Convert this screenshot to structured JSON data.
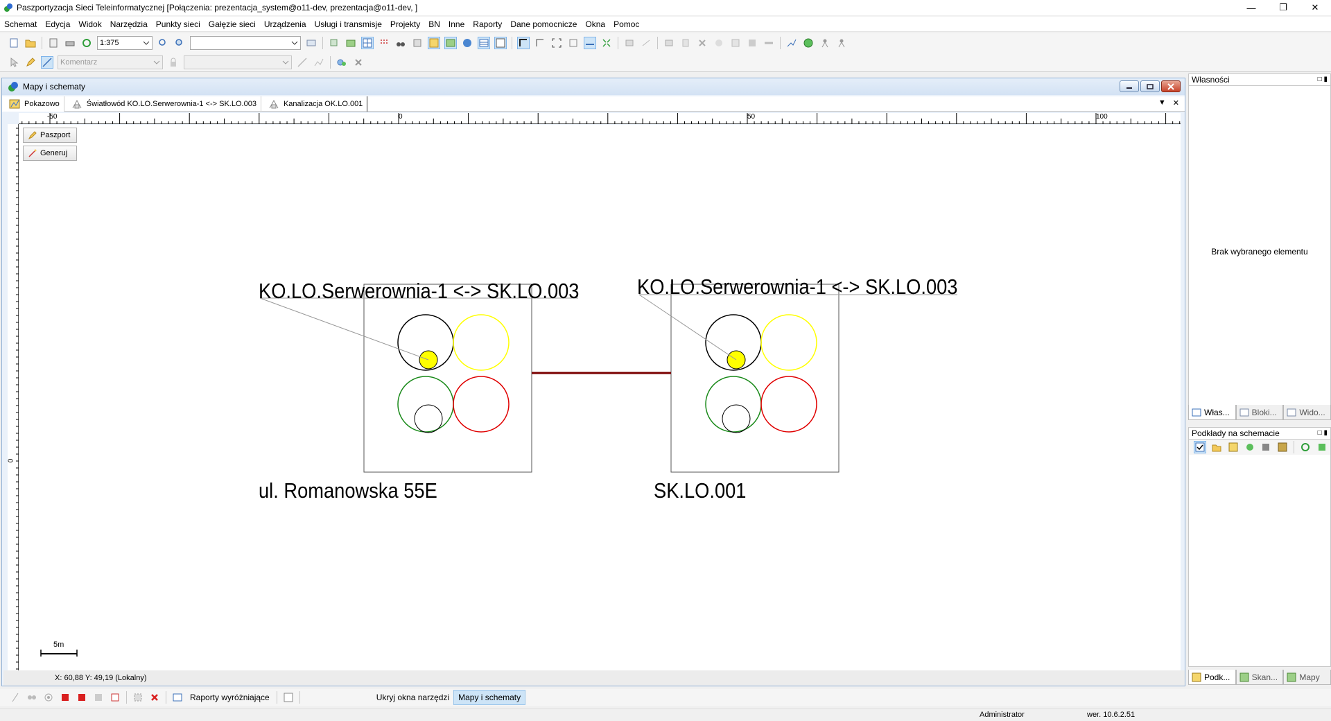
{
  "window": {
    "title": "Paszportyzacja Sieci Teleinformatycznej [Połączenia: prezentacja_system@o11-dev, prezentacja@o11-dev, ]"
  },
  "menu": [
    "Schemat",
    "Edycja",
    "Widok",
    "Narzędzia",
    "Punkty sieci",
    "Gałęzie sieci",
    "Urządzenia",
    "Usługi i transmisje",
    "Projekty",
    "BN",
    "Inne",
    "Raporty",
    "Dane pomocnicze",
    "Okna",
    "Pomoc"
  ],
  "toolbar": {
    "scale": "1:375",
    "layer_placeholder": "",
    "comment_placeholder": "Komentarz"
  },
  "mdi": {
    "title": "Mapy i schematy",
    "tabs": [
      {
        "label": "Pokazowo",
        "icon": "map-icon"
      },
      {
        "label": "Światłowód KO.LO.Serwerownia-1 <-> SK.LO.003",
        "icon": "duct-icon"
      },
      {
        "label": "Kanalizacja OK.LO.001",
        "icon": "duct-icon"
      }
    ],
    "ruler_labels": [
      "-50",
      "0",
      "50",
      "100"
    ],
    "vruler_label": "0",
    "buttons": {
      "passport": "Paszport",
      "generate": "Generuj"
    },
    "coords": "X: 60,88  Y: 49,19 (Lokalny)",
    "scalebar": "5m"
  },
  "schematic": {
    "left": {
      "label_top": "KO.LO.Serwerownia-1 <-> SK.LO.003",
      "label_bottom": "ul. Romanowska 55E"
    },
    "right": {
      "label_top": "KO.LO.Serwerownia-1 <-> SK.LO.003",
      "label_bottom": "SK.LO.001"
    },
    "colors": {
      "black": "#000000",
      "yellow": "#ffff00",
      "green": "#1a8a1a",
      "red": "#e00000",
      "link": "#7a0000"
    }
  },
  "properties": {
    "title": "Własności",
    "empty_text": "Brak wybranego elementu",
    "tabs": [
      "Włas...",
      "Bloki...",
      "Wido..."
    ]
  },
  "layers": {
    "title": "Podkłady na schemacie",
    "tabs": [
      "Podk...",
      "Skan...",
      "Mapy"
    ]
  },
  "bottombar": {
    "reports": "Raporty wyróżniające",
    "hide_tools": "Ukryj okna narzędzi",
    "maps": "Mapy i schematy"
  },
  "status": {
    "user": "Administrator",
    "version": "wer. 10.6.2.51"
  }
}
